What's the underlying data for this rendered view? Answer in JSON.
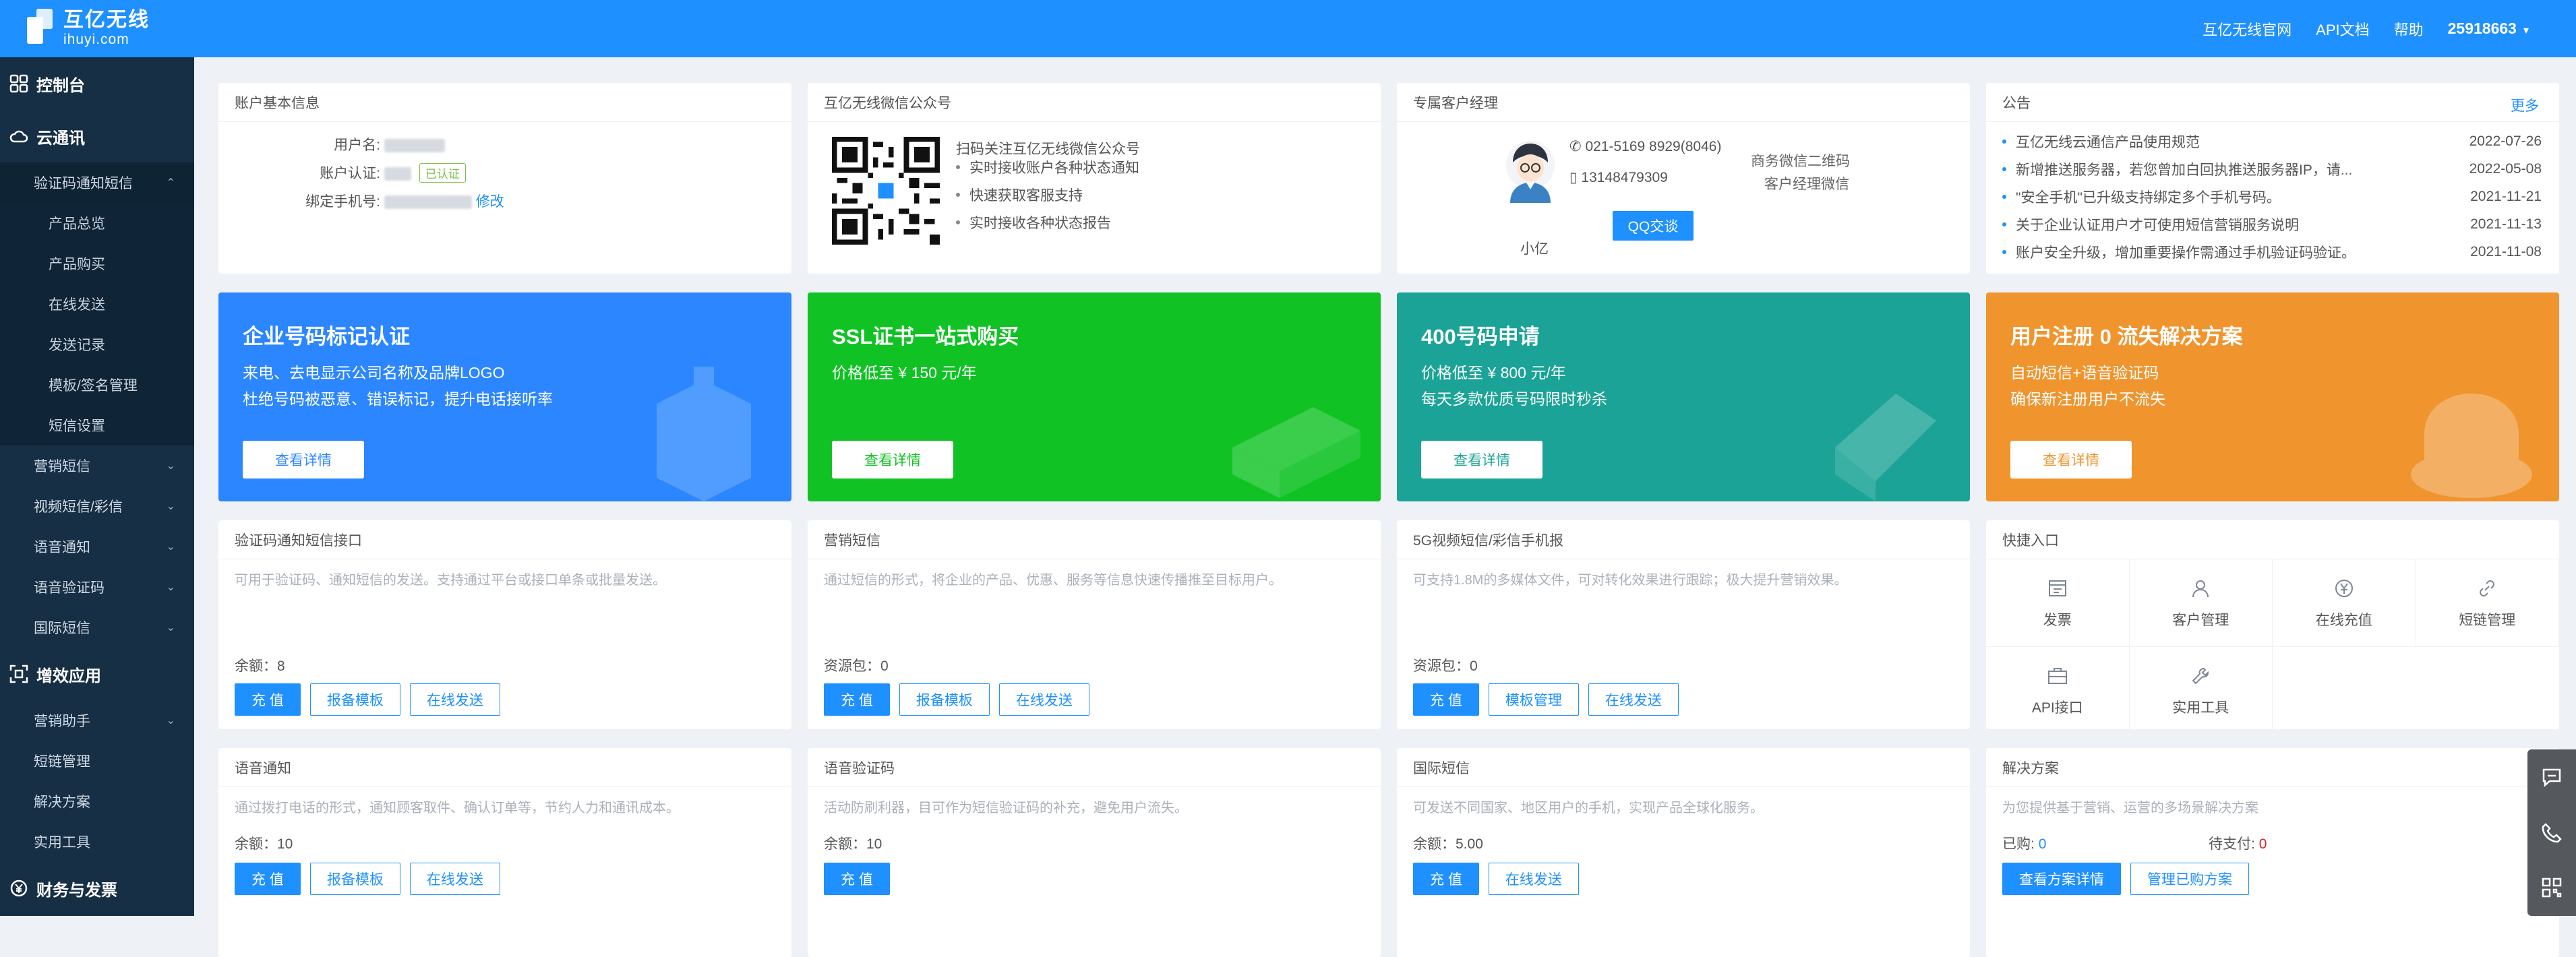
{
  "brand": {
    "name": "互亿无线",
    "domain": "ihuyi.com"
  },
  "topnav": {
    "site": "互亿无线官网",
    "api": "API文档",
    "help": "帮助",
    "user": "25918663"
  },
  "colors": {
    "topbar": "#1e90ff",
    "sidebar": "#162f44",
    "accent": "#1e90ff",
    "banner_blue": "#2b86ff",
    "banner_green": "#10c224",
    "banner_teal": "#1aa396",
    "banner_orange": "#f0942e"
  },
  "sidebar": {
    "console": "控制台",
    "cloud": "云通讯",
    "verify_sms": "验证码通知短信",
    "verify_sub": [
      "产品总览",
      "产品购买",
      "在线发送",
      "发送记录",
      "模板/签名管理",
      "短信设置"
    ],
    "items": [
      "营销短信",
      "视频短信/彩信",
      "语音通知",
      "语音验证码",
      "国际短信"
    ],
    "efficiency": "增效应用",
    "eff_items": [
      "营销助手",
      "短链管理",
      "解决方案",
      "实用工具"
    ],
    "finance": "财务与发票"
  },
  "account": {
    "title": "账户基本信息",
    "username_label": "用户名:",
    "auth_label": "账户认证:",
    "auth_badge": "已认证",
    "phone_label": "绑定手机号:",
    "modify": "修改"
  },
  "wechat": {
    "title": "互亿无线微信公众号",
    "line1": "扫码关注互亿无线微信公众号",
    "bullets": [
      "实时接收账户各种状态通知",
      "快速获取客服支持",
      "实时接收各种状态报告"
    ]
  },
  "manager": {
    "title": "专属客户经理",
    "name": "小亿",
    "phone": "021-5169 8929(8046)",
    "mobile": "13148479309",
    "qq_btn": "QQ交谈",
    "qr_alt": "商务微信二维码",
    "qr_caption": "客户经理微信"
  },
  "notice": {
    "title": "公告",
    "more": "更多",
    "items": [
      {
        "text": "互亿无线云通信产品使用规范",
        "date": "2022-07-26"
      },
      {
        "text": "新增推送服务器，若您曾加白回执推送服务器IP，请...",
        "date": "2022-05-08"
      },
      {
        "text": "\"安全手机\"已升级支持绑定多个手机号码。",
        "date": "2021-11-21"
      },
      {
        "text": "关于企业认证用户才可使用短信营销服务说明",
        "date": "2021-11-13"
      },
      {
        "text": "账户安全升级，增加重要操作需通过手机验证码验证。",
        "date": "2021-11-08"
      }
    ]
  },
  "banners": [
    {
      "title": "企业号码标记认证",
      "lines": [
        "来电、去电显示公司名称及品牌LOGO",
        "杜绝号码被恶意、错误标记，提升电话接听率"
      ],
      "btn": "查看详情"
    },
    {
      "title": "SSL证书一站式购买",
      "lines": [
        "价格低至 ¥ 150 元/年"
      ],
      "btn": "查看详情"
    },
    {
      "title": "400号码申请",
      "lines": [
        "价格低至 ¥ 800 元/年",
        "每天多款优质号码限时秒杀"
      ],
      "btn": "查看详情"
    },
    {
      "title": "用户注册 0 流失解决方案",
      "lines": [
        "自动短信+语音验证码",
        "确保新注册用户不流失"
      ],
      "btn": "查看详情"
    }
  ],
  "products": [
    {
      "title": "验证码通知短信接口",
      "desc": "可用于验证码、通知短信的发送。支持通过平台或接口单条或批量发送。",
      "balance": "余额：8",
      "buttons": [
        "充 值",
        "报备模板",
        "在线发送"
      ]
    },
    {
      "title": "营销短信",
      "desc": "通过短信的形式，将企业的产品、优惠、服务等信息快速传播推至目标用户。",
      "balance": "资源包：0",
      "buttons": [
        "充 值",
        "报备模板",
        "在线发送"
      ]
    },
    {
      "title": "5G视频短信/彩信手机报",
      "desc": "可支持1.8M的多媒体文件，可对转化效果进行跟踪；极大提升营销效果。",
      "balance": "资源包：0",
      "buttons": [
        "充 值",
        "模板管理",
        "在线发送"
      ]
    },
    {
      "title": "语音通知",
      "desc": "通过拨打电话的形式，通知顾客取件、确认订单等，节约人力和通讯成本。",
      "balance": "余额：10",
      "buttons": [
        "充 值",
        "报备模板",
        "在线发送"
      ]
    },
    {
      "title": "语音验证码",
      "desc": "活动防刷利器，目可作为短信验证码的补充，避免用户流失。",
      "balance": "余额：10",
      "buttons": [
        "充 值"
      ]
    },
    {
      "title": "国际短信",
      "desc": "可发送不同国家、地区用户的手机，实现产品全球化服务。",
      "balance": "余额：5.00",
      "buttons": [
        "充 值",
        "在线发送"
      ]
    }
  ],
  "quick": {
    "title": "快捷入口",
    "items": [
      {
        "label": "发票",
        "icon": "invoice-icon"
      },
      {
        "label": "客户管理",
        "icon": "user-icon"
      },
      {
        "label": "在线充值",
        "icon": "yen-icon"
      },
      {
        "label": "短链管理",
        "icon": "link-icon"
      },
      {
        "label": "API接口",
        "icon": "api-icon"
      },
      {
        "label": "实用工具",
        "icon": "tool-icon"
      }
    ]
  },
  "solution": {
    "title": "解决方案",
    "desc": "为您提供基于营销、运营的多场景解决方案",
    "bought_label": "已购:",
    "bought": "0",
    "pending_label": "待支付:",
    "pending": "0",
    "btn_view": "查看方案详情",
    "btn_manage": "管理已购方案"
  }
}
